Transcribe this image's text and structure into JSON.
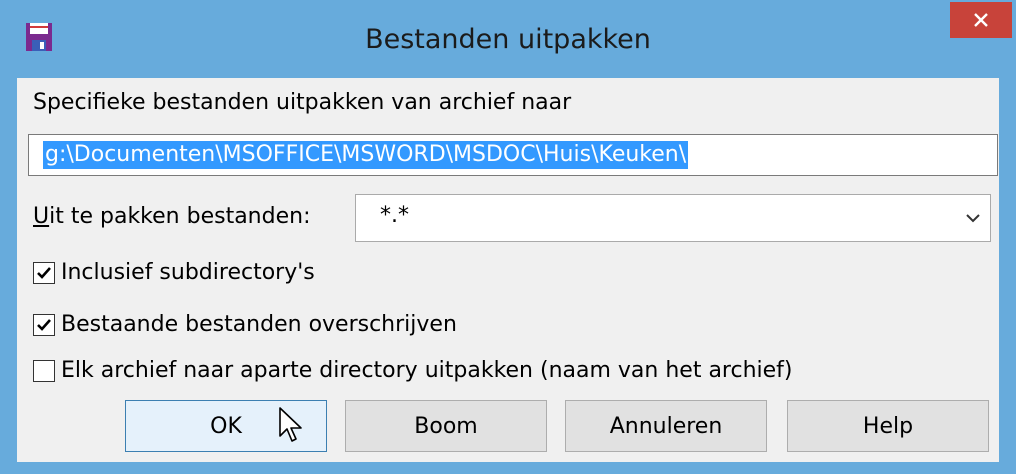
{
  "window": {
    "title": "Bestanden uitpakken",
    "app_icon": "floppy-disk-icon",
    "close_icon": "close-icon",
    "accent_color": "#67abdc",
    "close_color": "#c8433a"
  },
  "destination": {
    "label": "Specifieke bestanden uitpakken van archief naar",
    "value": "g:\\Documenten\\MSOFFICE\\MSWORD\\MSDOC\\Huis\\Keuken\\",
    "selected": true
  },
  "files": {
    "label_accel": "U",
    "label_rest": "it te pakken bestanden:",
    "value": "*.*",
    "dropdown_icon": "chevron-down-icon"
  },
  "options": [
    {
      "label": "Inclusief subdirectory's",
      "checked": true
    },
    {
      "label": "Bestaande bestanden overschrijven",
      "checked": true
    },
    {
      "label": "Elk archief naar aparte directory uitpakken (naam van het archief)",
      "checked": false
    }
  ],
  "buttons": {
    "ok": "OK",
    "tree": "Boom",
    "cancel": "Annuleren",
    "help": "Help"
  }
}
